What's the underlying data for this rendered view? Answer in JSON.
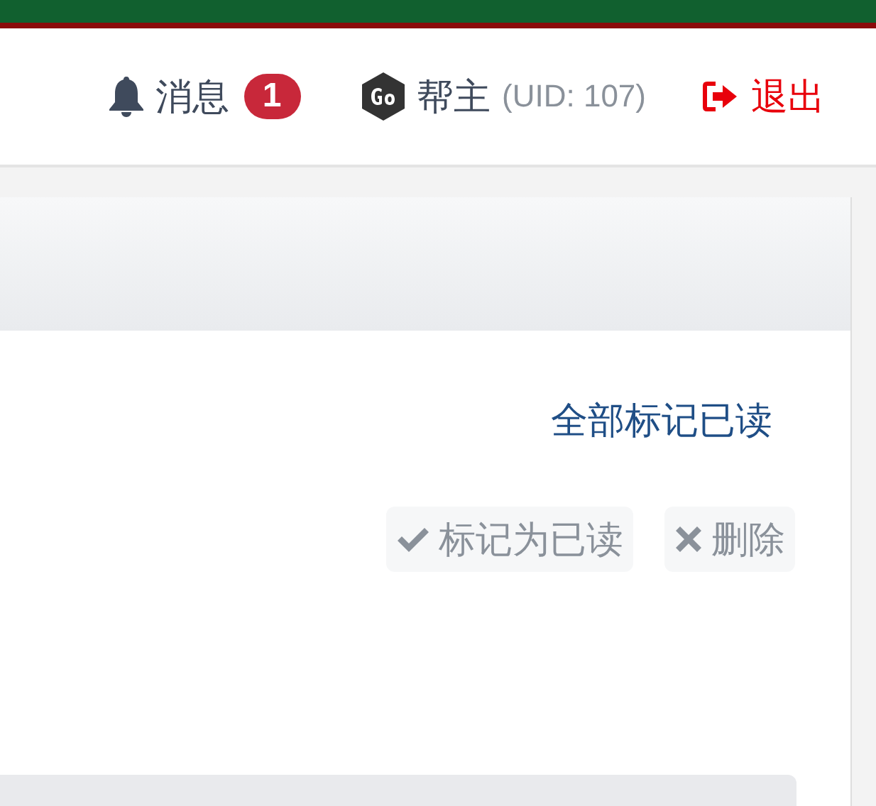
{
  "nav": {
    "messages": {
      "label": "消息",
      "badge": "1"
    },
    "user": {
      "name": "帮主",
      "uid": "(UID: 107)"
    },
    "logout": {
      "label": "退出"
    }
  },
  "card": {
    "mark_all_read": "全部标记已读",
    "actions": [
      {
        "kind": "mark_read",
        "label": "标记为已读"
      },
      {
        "kind": "delete",
        "label": "删除"
      }
    ]
  }
}
